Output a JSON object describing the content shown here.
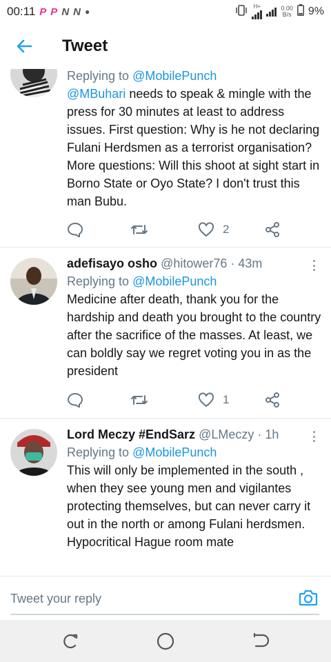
{
  "status_bar": {
    "time": "00:11",
    "notification_icons": [
      "P",
      "P",
      "N",
      "N"
    ],
    "net_speed": "0.00",
    "net_unit": "B/s",
    "network_type": "H+",
    "battery": "9%"
  },
  "header": {
    "title": "Tweet"
  },
  "tweets": [
    {
      "reply_prefix": "Replying to",
      "reply_to": "@MobilePunch",
      "mention": "@MBuhari",
      "text": " needs to speak & mingle with the press for 30 minutes at least to address issues. First question: Why is he not declaring Fulani Herdsmen as a terrorist organisation? More questions: Will this shoot at sight start in Borno State or Oyo State? I don't trust this man Bubu.",
      "likes": "2"
    },
    {
      "name": "adefisayo osho",
      "handle": "@hitower76 · 43m",
      "reply_prefix": "Replying to",
      "reply_to": "@MobilePunch",
      "text": "Medicine after death, thank you for the hardship and death you brought to the country after the sacrifice of the masses. At least, we can boldly say we regret voting you in as the president",
      "likes": "1"
    },
    {
      "name": "Lord Meczy #EndSarz",
      "handle": "@LMeczy · 1h",
      "reply_prefix": "Replying to",
      "reply_to": "@MobilePunch",
      "text_lines": [
        "This will only be implemented in the south , when they see young men and vigilantes protecting themselves, but can never carry it out in the north or among Fulani herdsmen.",
        "Hypocritical Hague room mate"
      ]
    }
  ],
  "reply_bar": {
    "placeholder": "Tweet your reply"
  },
  "colors": {
    "accent": "#1da1f2",
    "mention": "#1b95e0",
    "secondary_text": "#657786",
    "divider": "#e1e8ed"
  },
  "icons": {
    "back": "arrow-left-icon",
    "reply": "speech-bubble-icon",
    "retweet": "retweet-icon",
    "like": "heart-icon",
    "share": "share-icon",
    "more": "more-vertical-icon",
    "camera": "camera-icon",
    "nav": [
      "recents-icon",
      "home-icon",
      "back-icon"
    ]
  }
}
